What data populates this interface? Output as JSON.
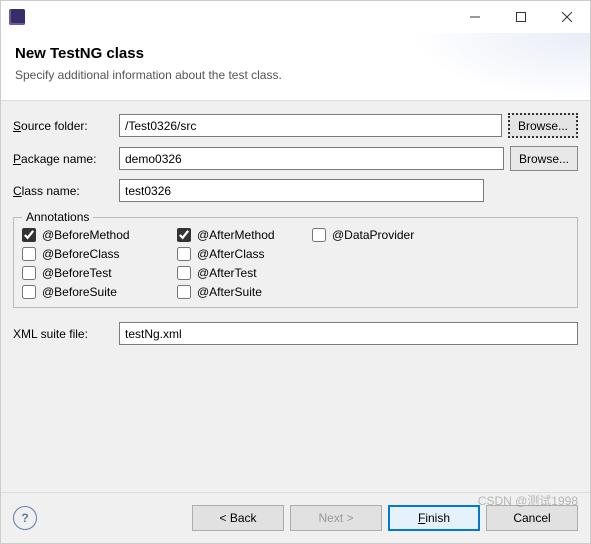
{
  "titlebar": {
    "title": ""
  },
  "header": {
    "title": "New TestNG class",
    "subtitle": "Specify additional information about the test class."
  },
  "form": {
    "source_folder_label": "Source folder:",
    "source_folder_mnemonic": "S",
    "source_folder_value": "/Test0326/src",
    "package_name_label": "Package name:",
    "package_name_mnemonic": "P",
    "package_name_value": "demo0326",
    "class_name_label": "Class name:",
    "class_name_mnemonic": "C",
    "class_name_value": "test0326",
    "browse_label": "Browse..."
  },
  "annotations": {
    "legend": "Annotations",
    "items": [
      {
        "label": "@BeforeMethod",
        "checked": true
      },
      {
        "label": "@AfterMethod",
        "checked": true
      },
      {
        "label": "@DataProvider",
        "checked": false
      },
      {
        "label": "@BeforeClass",
        "checked": false
      },
      {
        "label": "@AfterClass",
        "checked": false
      },
      {
        "label": "",
        "checked": null
      },
      {
        "label": "@BeforeTest",
        "checked": false
      },
      {
        "label": "@AfterTest",
        "checked": false
      },
      {
        "label": "",
        "checked": null
      },
      {
        "label": "@BeforeSuite",
        "checked": false
      },
      {
        "label": "@AfterSuite",
        "checked": false
      }
    ]
  },
  "xml": {
    "label": "XML suite file:",
    "value": "testNg.xml"
  },
  "footer": {
    "help": "?",
    "back": "< Back",
    "next": "Next >",
    "finish": "Finish",
    "cancel": "Cancel"
  },
  "watermark": "CSDN @测试1998"
}
